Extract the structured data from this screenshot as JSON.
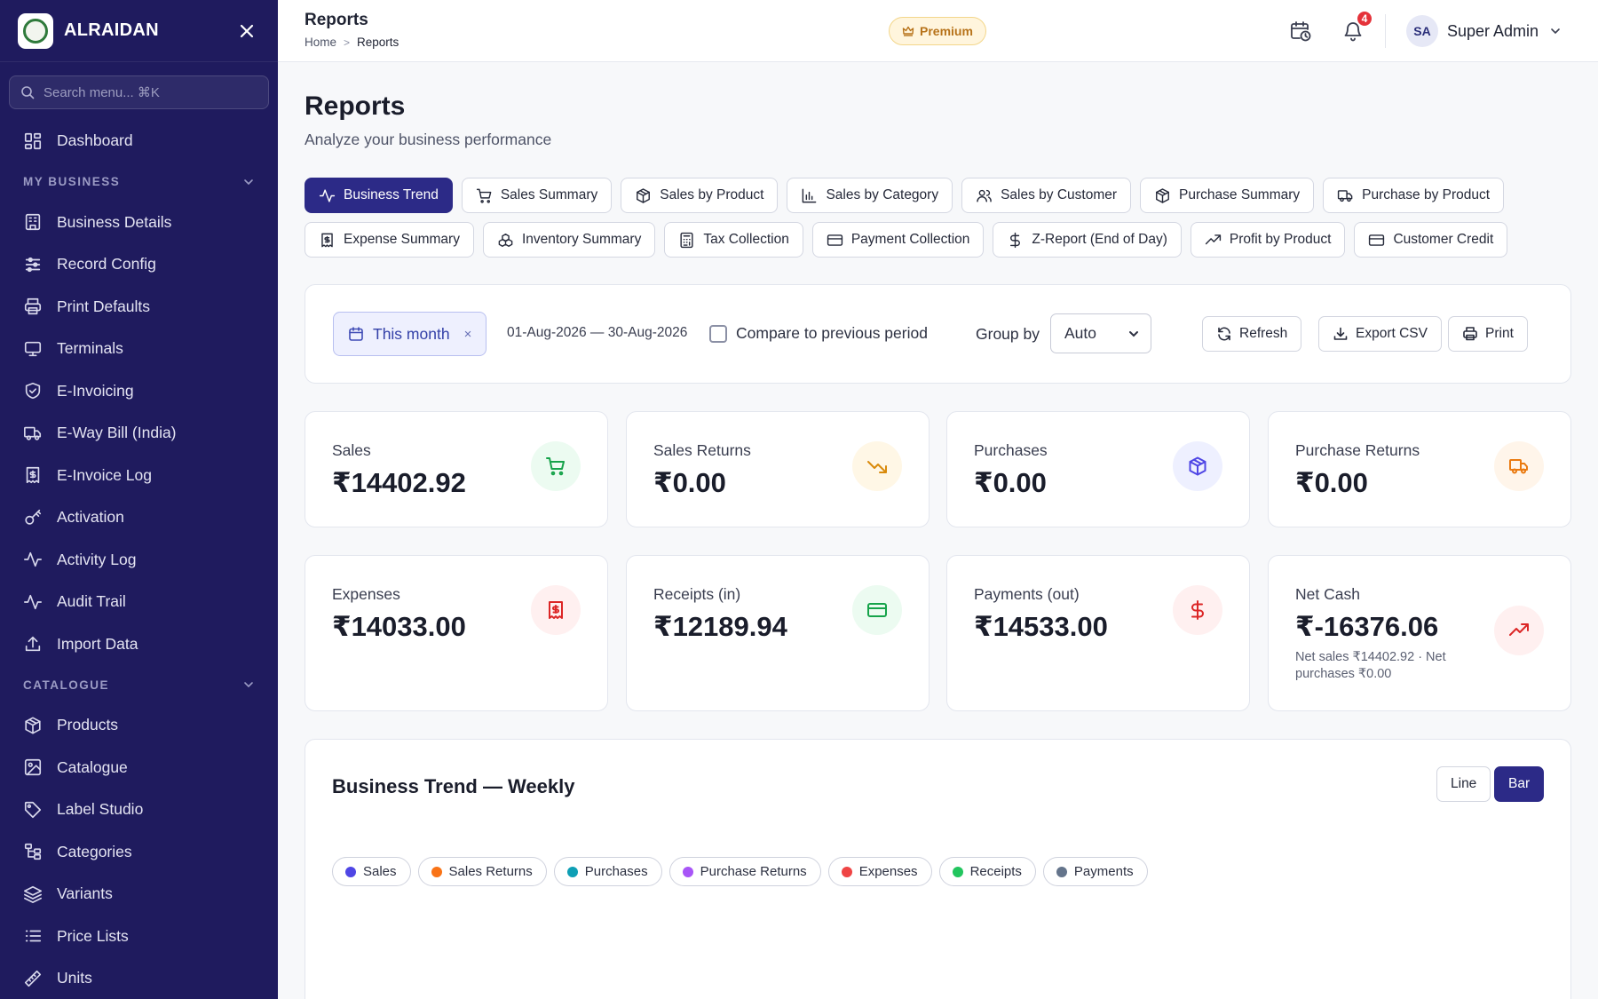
{
  "brand": {
    "name": "ALRAIDAN"
  },
  "sidebar": {
    "search_placeholder": "Search menu... ⌘K",
    "dashboard": "Dashboard",
    "sections": [
      {
        "title": "MY BUSINESS",
        "items": [
          {
            "label": "Business Details",
            "icon": "building-icon"
          },
          {
            "label": "Record Config",
            "icon": "sliders-icon"
          },
          {
            "label": "Print Defaults",
            "icon": "printer-icon"
          },
          {
            "label": "Terminals",
            "icon": "monitor-icon"
          },
          {
            "label": "E-Invoicing",
            "icon": "shield-check-icon"
          },
          {
            "label": "E-Way Bill (India)",
            "icon": "truck-icon"
          },
          {
            "label": "E-Invoice Log",
            "icon": "receipt-icon"
          },
          {
            "label": "Activation",
            "icon": "key-icon"
          },
          {
            "label": "Activity Log",
            "icon": "activity-icon"
          },
          {
            "label": "Audit Trail",
            "icon": "activity-icon"
          },
          {
            "label": "Import Data",
            "icon": "upload-icon"
          }
        ]
      },
      {
        "title": "CATALOGUE",
        "items": [
          {
            "label": "Products",
            "icon": "package-icon"
          },
          {
            "label": "Catalogue",
            "icon": "image-icon"
          },
          {
            "label": "Label Studio",
            "icon": "tag-icon"
          },
          {
            "label": "Categories",
            "icon": "tree-icon"
          },
          {
            "label": "Variants",
            "icon": "layers-icon"
          },
          {
            "label": "Price Lists",
            "icon": "list-icon"
          },
          {
            "label": "Units",
            "icon": "ruler-icon"
          }
        ]
      }
    ]
  },
  "topbar": {
    "title": "Reports",
    "breadcrumb": {
      "home": "Home",
      "sep": ">",
      "current": "Reports"
    },
    "premium_label": "Premium",
    "notification_count": "4",
    "user_initials": "SA",
    "user_name": "Super Admin"
  },
  "page": {
    "title": "Reports",
    "subtitle": "Analyze your business performance"
  },
  "tabs": [
    {
      "label": "Business Trend",
      "icon": "activity-icon",
      "active": true
    },
    {
      "label": "Sales Summary",
      "icon": "cart-icon"
    },
    {
      "label": "Sales by Product",
      "icon": "package-icon"
    },
    {
      "label": "Sales by Category",
      "icon": "bar-chart-icon"
    },
    {
      "label": "Sales by Customer",
      "icon": "users-icon"
    },
    {
      "label": "Purchase Summary",
      "icon": "package-icon"
    },
    {
      "label": "Purchase by Product",
      "icon": "truck-icon"
    },
    {
      "label": "Expense Summary",
      "icon": "receipt-icon"
    },
    {
      "label": "Inventory Summary",
      "icon": "boxes-icon"
    },
    {
      "label": "Tax Collection",
      "icon": "calculator-icon"
    },
    {
      "label": "Payment Collection",
      "icon": "credit-card-icon"
    },
    {
      "label": "Z-Report (End of Day)",
      "icon": "dollar-icon"
    },
    {
      "label": "Profit by Product",
      "icon": "trending-up-icon"
    },
    {
      "label": "Customer Credit",
      "icon": "credit-card-icon"
    }
  ],
  "filters": {
    "period": "This month",
    "period_clear": "×",
    "date_range": "01-Aug-2026 — 30-Aug-2026",
    "compare_label": "Compare to previous period",
    "group_by_label": "Group by",
    "group_by_value": "Auto",
    "refresh": "Refresh",
    "export_csv": "Export CSV",
    "print": "Print"
  },
  "kpis": [
    {
      "label": "Sales",
      "value": "₹14402.92",
      "icon": "cart-icon",
      "color": "#16a34a",
      "bg": "#ecfbf1"
    },
    {
      "label": "Sales Returns",
      "value": "₹0.00",
      "icon": "trending-down-icon",
      "color": "#d98a0b",
      "bg": "#fff7e6"
    },
    {
      "label": "Purchases",
      "value": "₹0.00",
      "icon": "package-icon",
      "color": "#4f46e5",
      "bg": "#eef0ff"
    },
    {
      "label": "Purchase Returns",
      "value": "₹0.00",
      "icon": "truck-icon",
      "color": "#ea7a10",
      "bg": "#fff5ea"
    },
    {
      "label": "Expenses",
      "value": "₹14033.00",
      "icon": "receipt-icon",
      "color": "#dc2626",
      "bg": "#fff0f0"
    },
    {
      "label": "Receipts (in)",
      "value": "₹12189.94",
      "icon": "credit-card-icon",
      "color": "#16a34a",
      "bg": "#ecfbf1"
    },
    {
      "label": "Payments (out)",
      "value": "₹14533.00",
      "icon": "dollar-icon",
      "color": "#dc2626",
      "bg": "#fff0f0"
    },
    {
      "label": "Net Cash",
      "value": "₹-16376.06",
      "note": "Net sales ₹14402.92 · Net purchases ₹0.00",
      "icon": "trending-up-icon",
      "color": "#dc2626",
      "bg": "#fff0f0"
    }
  ],
  "trend": {
    "title": "Business Trend — Weekly",
    "line_label": "Line",
    "bar_label": "Bar",
    "active_view": "Bar",
    "legend": [
      {
        "name": "Sales",
        "color": "#4f46e5"
      },
      {
        "name": "Sales Returns",
        "color": "#f97316"
      },
      {
        "name": "Purchases",
        "color": "#0e9fb5"
      },
      {
        "name": "Purchase Returns",
        "color": "#a855f7"
      },
      {
        "name": "Expenses",
        "color": "#ef4444"
      },
      {
        "name": "Receipts",
        "color": "#22c55e"
      },
      {
        "name": "Payments",
        "color": "#64748b"
      }
    ]
  }
}
